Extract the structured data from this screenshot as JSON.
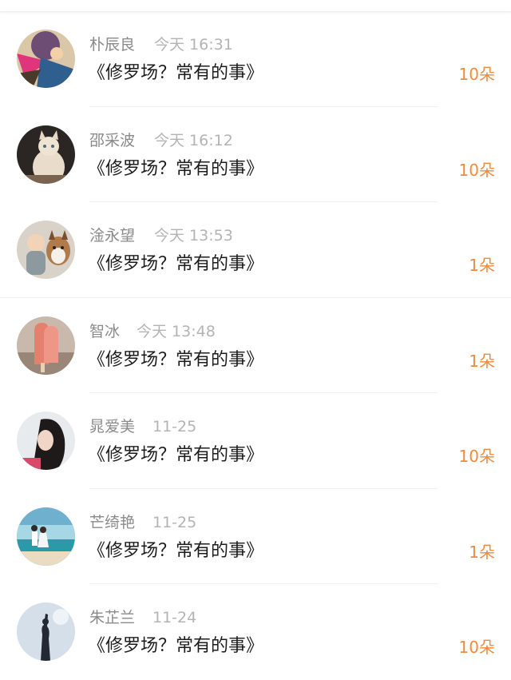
{
  "entries": [
    {
      "name": "朴辰良",
      "time": "今天 16:31",
      "title": "《修罗场？常有的事》",
      "count": "10朵",
      "avatar": "avatar-hero-icon"
    },
    {
      "name": "邵采波",
      "time": "今天 16:12",
      "title": "《修罗场？常有的事》",
      "count": "10朵",
      "avatar": "avatar-cat-icon"
    },
    {
      "name": "淦永望",
      "time": "今天 13:53",
      "title": "《修罗场？常有的事》",
      "count": "1朵",
      "avatar": "avatar-baby-dog-icon"
    },
    {
      "name": "智冰",
      "time": "今天 13:48",
      "title": "《修罗场？常有的事》",
      "count": "1朵",
      "avatar": "avatar-popsicle-icon"
    },
    {
      "name": "晁爱美",
      "time": "11-25",
      "title": "《修罗场？常有的事》",
      "count": "10朵",
      "avatar": "avatar-girl-icon"
    },
    {
      "name": "芒绮艳",
      "time": "11-25",
      "title": "《修罗场？常有的事》",
      "count": "1朵",
      "avatar": "avatar-beach-couple-icon"
    },
    {
      "name": "朱芷兰",
      "time": "11-24",
      "title": "《修罗场？常有的事》",
      "count": "10朵",
      "avatar": "avatar-silhouette-icon"
    }
  ],
  "colors": {
    "accent": "#f08a3c",
    "name": "#8a8a8a",
    "time": "#b4b4b4",
    "title": "#1c1c1c"
  }
}
